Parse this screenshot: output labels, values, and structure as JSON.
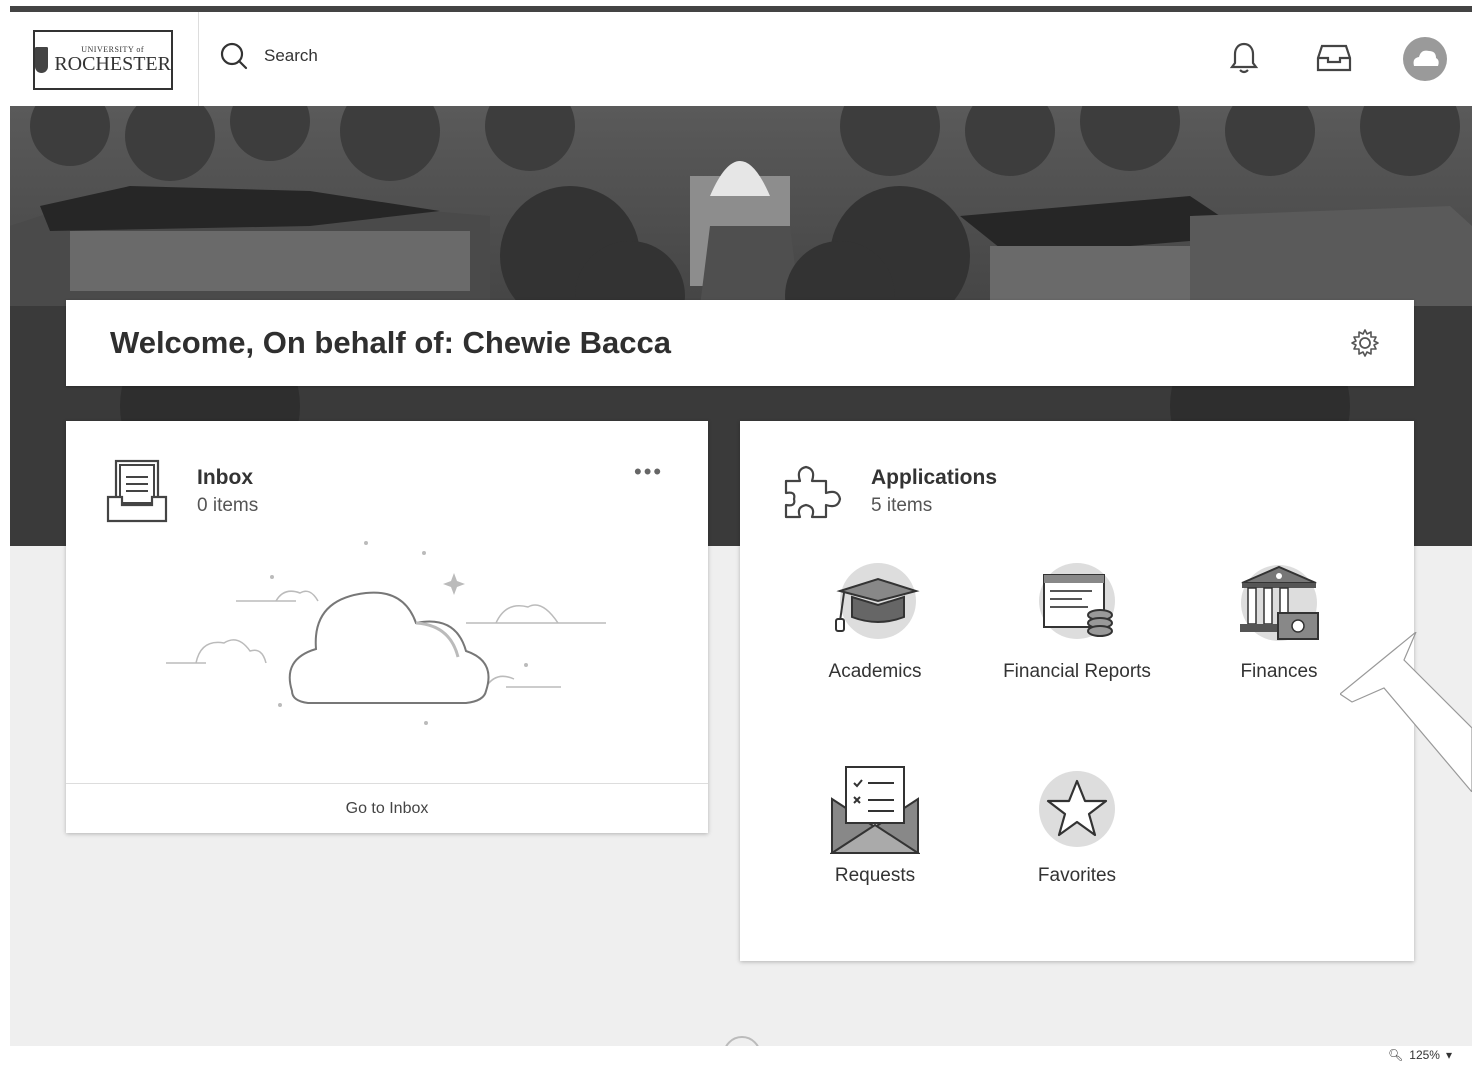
{
  "header": {
    "logo_small": "UNIVERSITY of",
    "logo_big": "ROCHESTER",
    "search_label": "Search",
    "icons": [
      "bell-icon",
      "inbox-tray-icon",
      "avatar-cloud-icon"
    ]
  },
  "welcome": {
    "text": "Welcome, On behalf of: Chewie Bacca"
  },
  "inbox": {
    "title": "Inbox",
    "count": "0 items",
    "more": "•••",
    "link": "Go to Inbox"
  },
  "applications": {
    "title": "Applications",
    "count": "5 items",
    "items": [
      {
        "label": "Academics",
        "icon": "graduation-cap-icon"
      },
      {
        "label": "Financial Reports",
        "icon": "financial-report-icon"
      },
      {
        "label": "Finances",
        "icon": "bank-building-icon"
      },
      {
        "label": "Requests",
        "icon": "envelope-checklist-icon"
      },
      {
        "label": "Favorites",
        "icon": "star-icon"
      }
    ]
  },
  "status": {
    "zoom": "125%"
  },
  "colors": {
    "background": "#efefef",
    "card": "#ffffff",
    "text": "#333333"
  }
}
